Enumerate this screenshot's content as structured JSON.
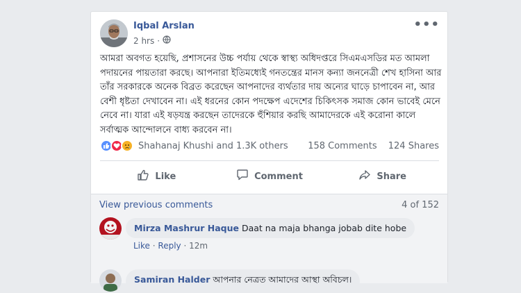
{
  "post": {
    "author": "Iqbal Arslan",
    "time": "2 hrs",
    "privacy_icon": "globe-icon",
    "more_icon": "more-dots-icon",
    "text": "আমরা অবগত হয়েছি, প্রশাসনের উচ্চ পর্যায় থেকে স্বাস্থ্য অধিদপ্তরে সিএমএসডির মত আমলা পদায়নের পায়তারা করছে। আপনারা ইতিমধ্যেই গনতন্ত্রের মানস কন্যা জননেত্রী শেখ হাসিনা আর তাঁর সরকারকে অনেক বিব্রত করেছেন আপনাদের ব্যর্থতার দায় অন্যের ঘাড়ে চাপাবেন না, আর বেশী ধৃষ্টতা দেখাবেন না। এই ধরনের কোন পদক্ষেপ এদেশের চিকিৎসক সমাজ কোন ভাবেই মেনে নেবে না। যারা এই ষড়যন্ত্র করছেন তাদেরকে হুঁশিয়ার করছি আমাদেরকে এই করোনা কালে সর্বাত্মক আন্দোলনে বাধ্য করবেন না।"
  },
  "reactions": {
    "icons": [
      "like-reaction-icon",
      "love-reaction-icon",
      "sad-reaction-icon"
    ],
    "names": "Shahanaj Khushi and 1.3K others",
    "comments_count": "158 Comments",
    "shares_count": "124 Shares"
  },
  "actions": {
    "like": "Like",
    "comment": "Comment",
    "share": "Share"
  },
  "comments": {
    "view_previous": "View previous comments",
    "pager": "4 of 152",
    "items": [
      {
        "author": "Mirza Mashrur Haque",
        "text": "Daat na maja bhanga jobab dite hobe",
        "like": "Like",
        "reply": "Reply",
        "time": "12m"
      },
      {
        "author": "Samiran Halder",
        "text": "আপনার নেত্রত আমাদের আস্থা অবিচল।"
      }
    ]
  },
  "colors": {
    "link": "#385898",
    "background": "#e9ebee",
    "like_reaction": "#5890ff",
    "love_reaction": "#f0284a",
    "sad_reaction": "#f7b125"
  }
}
